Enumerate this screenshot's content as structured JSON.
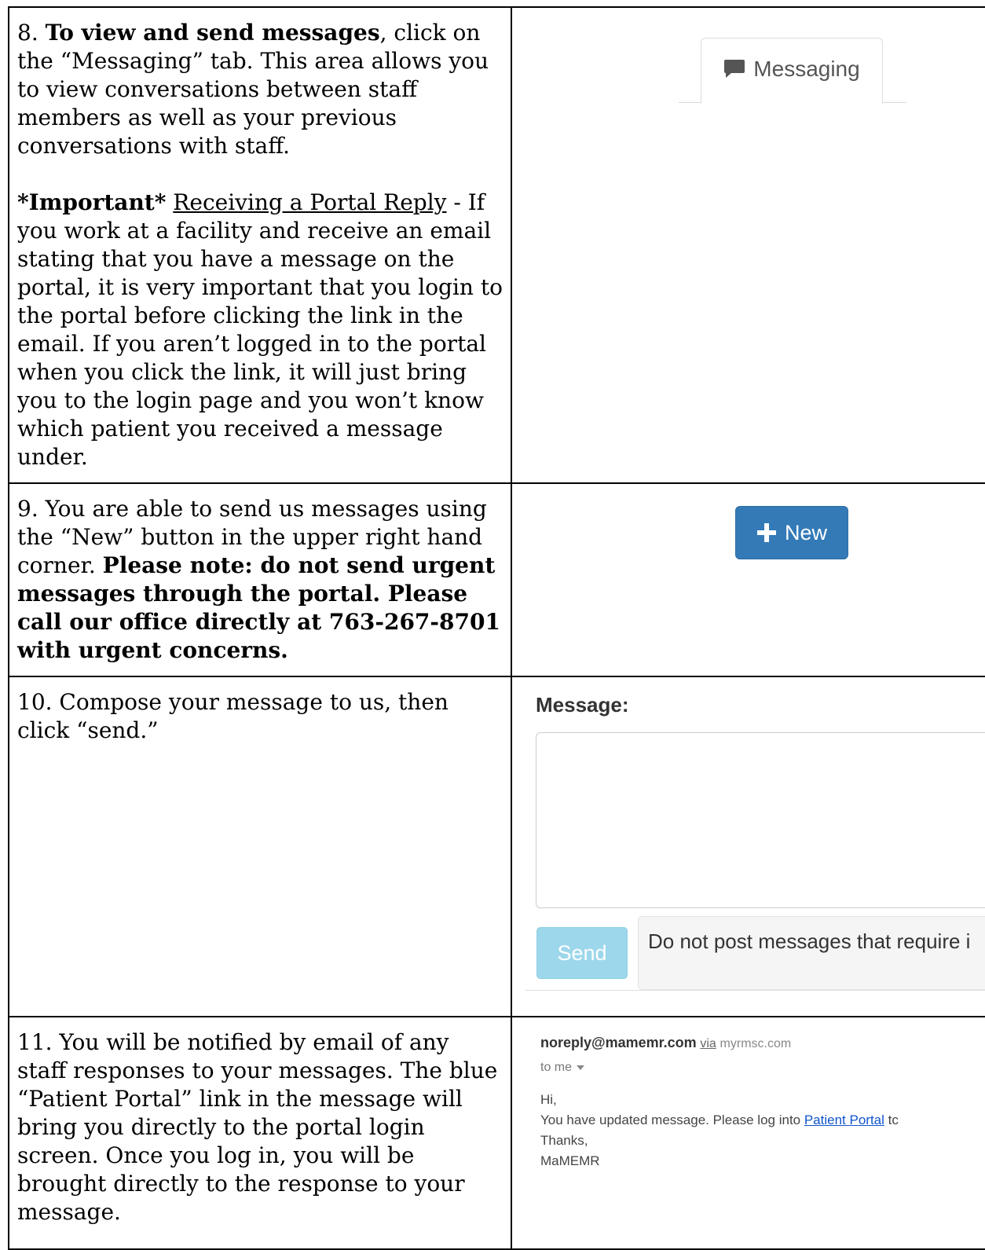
{
  "step8": {
    "num": "8.",
    "bold_intro": "To view and send messages",
    "text_rest": ", click on the “Messaging” tab. This area allows you to view conversations between staff members as well as your previous conversations with staff.",
    "important_label": "*Important*",
    "important_heading": "Receiving a Portal Reply",
    "important_text": " - If you work at a facility and receive an email stating that you have a message on the portal, it is very important that you login to the portal before clicking the link in the email. If you aren’t logged in to the portal when you click the link, it will just bring you to the login page and you won’t know which patient you received a message under.",
    "tab_label": "Messaging"
  },
  "step9": {
    "text": "9. You are able to send us messages using the “New” button in the upper right hand corner. ",
    "bold_note": "Please note: do not send urgent messages through the portal. Please call our office directly at 763-267-8701 with urgent concerns.",
    "button_label": "New"
  },
  "step10": {
    "text": "10. Compose your message to us, then click “send.”",
    "message_label": "Message:",
    "send_label": "Send",
    "notice_text": "Do not post messages that require i"
  },
  "step11": {
    "text": "11. You will be notified by email of any staff responses to your messages. The blue “Patient Portal” link in the message will bring you directly to the portal login screen. Once you log in, you will be brought directly to the response to your message.",
    "email": {
      "from": "noreply@mamemr.com",
      "via": "via",
      "domain": "myrmsc.com",
      "to": "to me",
      "greeting": "Hi,",
      "body_before": "You have updated message. Please log into ",
      "link_text": "Patient Portal",
      "body_after": " tc",
      "thanks": "Thanks,",
      "signature": "MaMEMR"
    }
  }
}
